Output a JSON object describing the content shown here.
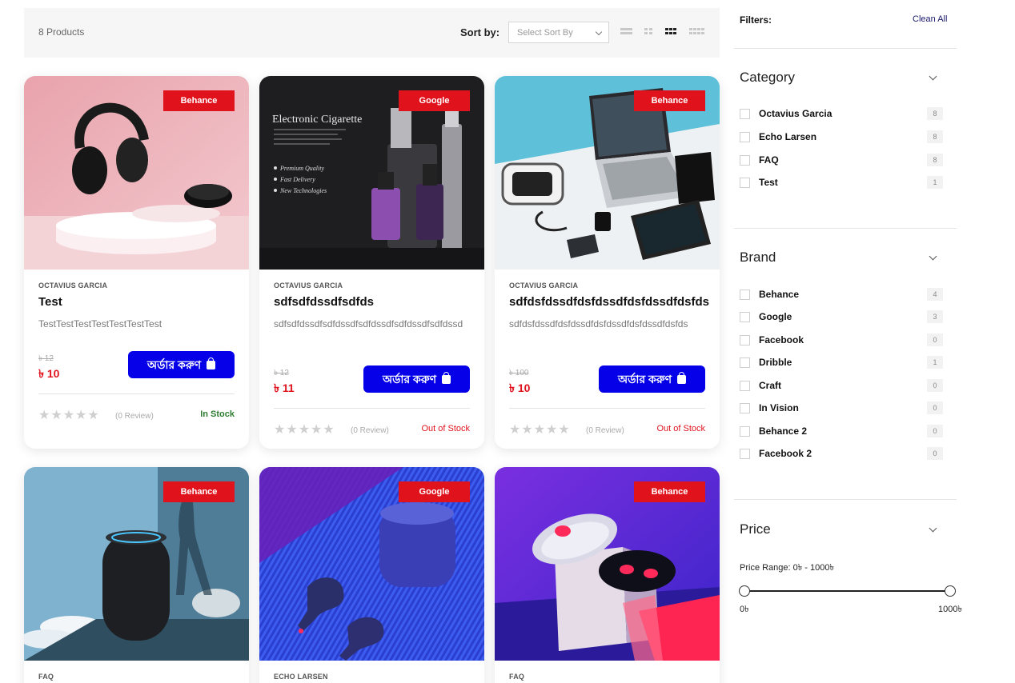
{
  "toolbar": {
    "product_count": "8 Products",
    "sort_label": "Sort by:",
    "sort_placeholder": "Select Sort By",
    "views": [
      "list-view-icon",
      "small-grid-icon",
      "grid-view-icon",
      "large-grid-icon"
    ],
    "active_view": "grid-view-icon"
  },
  "products": [
    {
      "badge": "Behance",
      "category": "OCTAVIUS GARCIA",
      "title": "Test",
      "desc": "TestTestTestTestTestTestTest",
      "old_price": "৳ 12",
      "price": "৳ 10",
      "button": "অর্ডার করুণ",
      "reviews": "(0 Review)",
      "stock": "In Stock",
      "stock_color": "#2e7d32",
      "rating": 0
    },
    {
      "badge": "Google",
      "category": "OCTAVIUS GARCIA",
      "title": "sdfsdfdssdfsdfds",
      "desc": "sdfsdfdssdfsdfdssdfsdfdssdfsdfdssdfsdfdssd",
      "old_price": "৳ 12",
      "price": "৳ 11",
      "button": "অর্ডার করুণ",
      "reviews": "(0 Review)",
      "stock": "Out of Stock",
      "stock_color": "#e0131d",
      "rating": 0
    },
    {
      "badge": "Behance",
      "category": "OCTAVIUS GARCIA",
      "title": "sdfdsfdssdfdsfdssdfdsfdssdfdsfds",
      "desc": "sdfdsfdssdfdsfdssdfdsfdssdfdsfdssdfdsfds",
      "old_price": "৳ 100",
      "price": "৳ 10",
      "button": "অর্ডার করুণ",
      "reviews": "(0 Review)",
      "stock": "Out of Stock",
      "stock_color": "#e0131d",
      "rating": 0
    },
    {
      "badge": "Behance",
      "category": "FAQ"
    },
    {
      "badge": "Google",
      "category": "ECHO LARSEN"
    },
    {
      "badge": "Behance",
      "category": "FAQ"
    }
  ],
  "image_text": {
    "ecig_title": "Electronic Cigarette",
    "ecig_bullets": [
      "Premium Quality",
      "Fast Delivery",
      "New Technologies"
    ]
  },
  "sidebar": {
    "filters_label": "Filters:",
    "clean_all": "Clean All",
    "category": {
      "title": "Category",
      "items": [
        {
          "label": "Octavius Garcia",
          "count": "8"
        },
        {
          "label": "Echo Larsen",
          "count": "8"
        },
        {
          "label": "FAQ",
          "count": "8"
        },
        {
          "label": "Test",
          "count": "1"
        }
      ]
    },
    "brand": {
      "title": "Brand",
      "items": [
        {
          "label": "Behance",
          "count": "4"
        },
        {
          "label": "Google",
          "count": "3"
        },
        {
          "label": "Facebook",
          "count": "0"
        },
        {
          "label": "Dribble",
          "count": "1"
        },
        {
          "label": "Craft",
          "count": "0"
        },
        {
          "label": "In Vision",
          "count": "0"
        },
        {
          "label": "Behance 2",
          "count": "0"
        },
        {
          "label": "Facebook 2",
          "count": "0"
        }
      ]
    },
    "price": {
      "title": "Price",
      "range_label": "Price Range: 0৳ - 1000৳",
      "min_label": "0৳",
      "max_label": "1000৳",
      "min_value": 0,
      "max_value": 1000
    }
  },
  "colors": {
    "accent": "#0500e8",
    "badge": "#e0131d",
    "price": "#e0131d"
  }
}
